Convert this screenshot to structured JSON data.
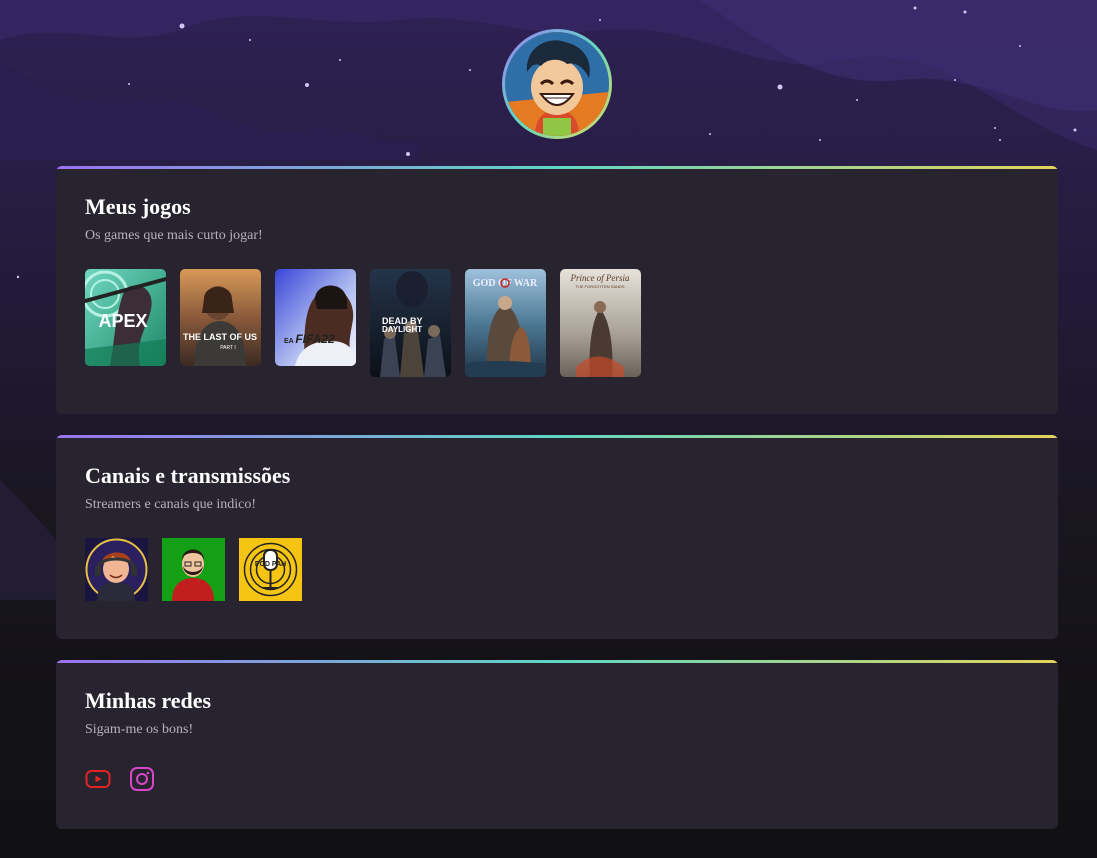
{
  "profile": {
    "avatar_icon": "anime-avatar-icon"
  },
  "sections": {
    "games": {
      "title": "Meus jogos",
      "subtitle": "Os games que mais curto jogar!",
      "items": [
        {
          "label": "APEX",
          "sublabel": ""
        },
        {
          "label": "THE LAST OF US",
          "sublabel": "PART I"
        },
        {
          "label": "FIFA22",
          "sublabel": "EA"
        },
        {
          "label": "DEAD BY",
          "sublabel": "DAYLIGHT"
        },
        {
          "label": "GOD OF WAR",
          "sublabel": ""
        },
        {
          "label": "Prince of Persia",
          "sublabel": "THE FORGOTTEN SANDS"
        }
      ]
    },
    "channels": {
      "title": "Canais e transmissões",
      "subtitle": "Streamers e canais que indico!",
      "items": [
        {
          "icon": "streamer-avatar-icon"
        },
        {
          "icon": "bearded-streamer-icon"
        },
        {
          "icon": "podpah-logo-icon",
          "label": "POD PAH"
        }
      ]
    },
    "socials": {
      "title": "Minhas redes",
      "subtitle": "Sigam-me os bons!",
      "items": [
        {
          "icon": "youtube-icon",
          "color": "#e02424"
        },
        {
          "icon": "instagram-icon",
          "color": "#d946c8"
        }
      ]
    }
  },
  "colors": {
    "card_bg": "#27232f",
    "accent_gradient": [
      "#9b72f0",
      "#5fd6c4",
      "#e3d35b"
    ]
  }
}
